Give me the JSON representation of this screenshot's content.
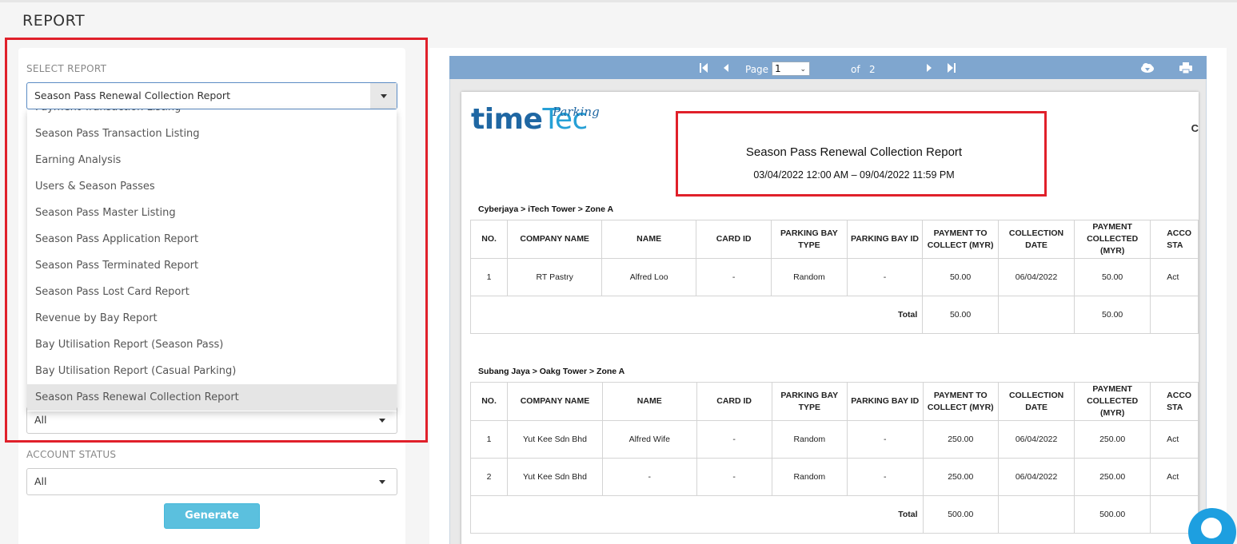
{
  "page": {
    "title": "REPORT"
  },
  "form": {
    "select_report_label": "SELECT REPORT",
    "select_report_value": "Season Pass Renewal Collection Report",
    "dropdown_options": [
      "Payment Transaction Listing",
      "Season Pass Transaction Listing",
      "Earning Analysis",
      "Users & Season Passes",
      "Season Pass Master Listing",
      "Season Pass Application Report",
      "Season Pass Terminated Report",
      "Season Pass Lost Card Report",
      "Revenue by Bay Report",
      "Bay Utilisation Report (Season Pass)",
      "Bay Utilisation Report (Casual Parking)",
      "Season Pass Renewal Collection Report"
    ],
    "hidden_field_value": "All",
    "account_status_label": "ACCOUNT STATUS",
    "account_status_value": "All",
    "generate_label": "Generate"
  },
  "viewer": {
    "page_label": "Page",
    "page_value": "1",
    "of_label": "of",
    "total_pages": "2",
    "icons": [
      "first-page-icon",
      "prev-page-icon",
      "next-page-icon",
      "last-page-icon",
      "download-icon",
      "print-icon"
    ]
  },
  "report": {
    "logo_time": "time",
    "logo_tec": "Tec",
    "logo_parking": "Parking",
    "corner_text": "C",
    "title": "Season Pass Renewal Collection Report",
    "date_range": "03/04/2022 12:00 AM – 09/04/2022 11:59 PM",
    "headers": [
      "NO.",
      "COMPANY NAME",
      "NAME",
      "CARD ID",
      "PARKING BAY TYPE",
      "PARKING BAY ID",
      "PAYMENT TO COLLECT (MYR)",
      "COLLECTION DATE",
      "PAYMENT COLLECTED (MYR)",
      "ACCO STA"
    ],
    "sections": [
      {
        "zone": "Cyberjaya > iTech Tower > Zone A",
        "rows": [
          [
            "1",
            "RT Pastry",
            "Alfred Loo",
            "-",
            "Random",
            "-",
            "50.00",
            "06/04/2022",
            "50.00",
            "Act"
          ]
        ],
        "total_label": "Total",
        "total_to_collect": "50.00",
        "total_collected": "50.00"
      },
      {
        "zone": "Subang Jaya > Oakg Tower > Zone A",
        "rows": [
          [
            "1",
            "Yut Kee Sdn Bhd",
            "Alfred Wife",
            "-",
            "Random",
            "-",
            "250.00",
            "06/04/2022",
            "250.00",
            "Act"
          ],
          [
            "2",
            "Yut Kee Sdn Bhd",
            "-",
            "-",
            "Random",
            "-",
            "250.00",
            "06/04/2022",
            "250.00",
            "Act"
          ]
        ],
        "total_label": "Total",
        "total_to_collect": "500.00",
        "total_collected": "500.00"
      }
    ]
  },
  "colors": {
    "highlight_border": "#e0202a",
    "toolbar": "#7fa6cf",
    "generate_button": "#5bc0de",
    "chat_bubble": "#1d9fe0"
  }
}
